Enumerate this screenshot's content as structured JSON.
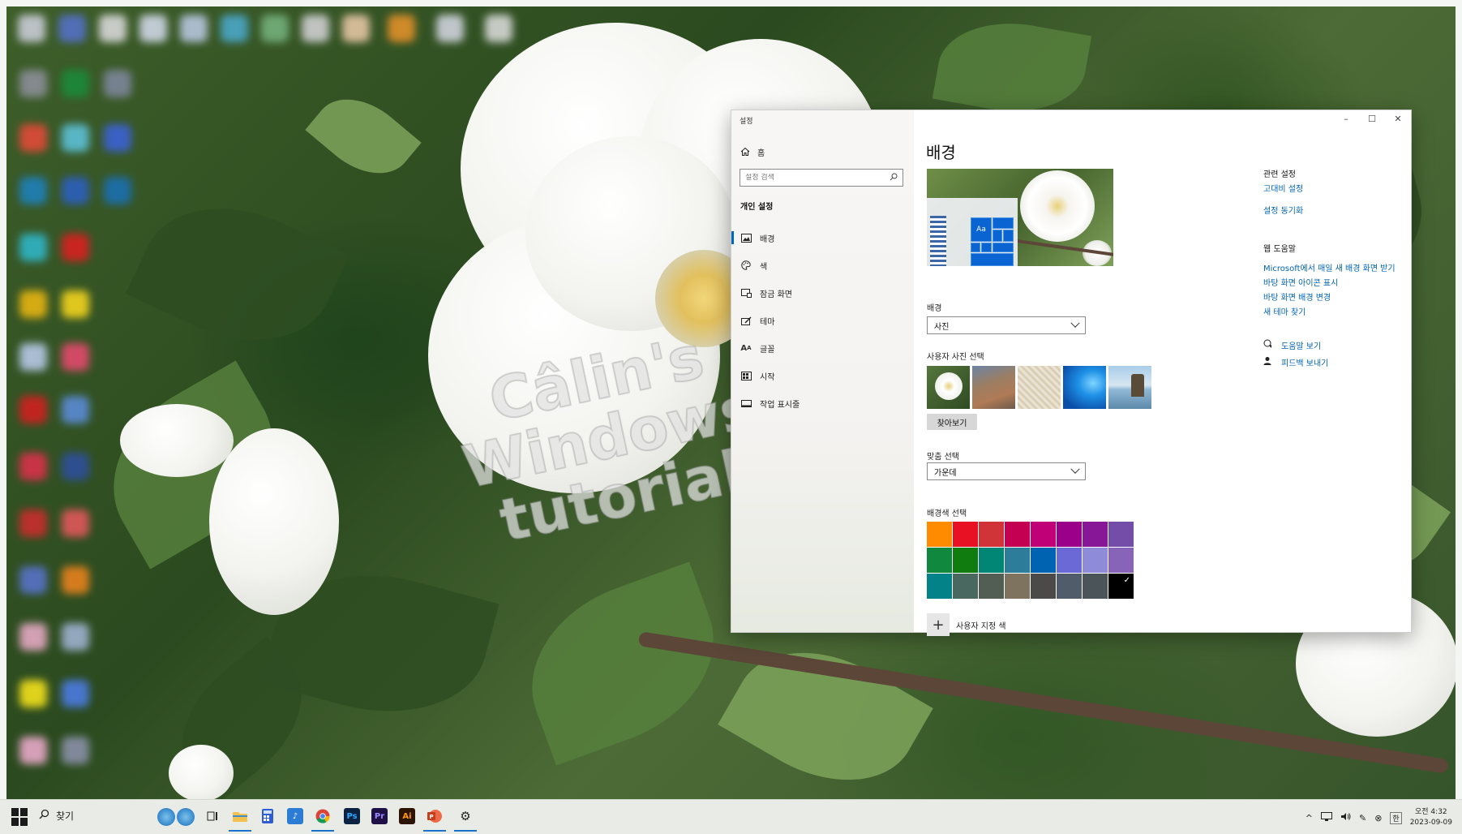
{
  "watermark": {
    "line1": "Câlin's",
    "line2": "Windows",
    "line3": "tutorial"
  },
  "settings": {
    "window_title": "설정",
    "controls": {
      "minimize": "–",
      "maximize": "☐",
      "close": "✕"
    },
    "nav": {
      "home_label": "홈",
      "search_placeholder": "설정 검색",
      "section_title": "개인 설정",
      "items": [
        {
          "label": "배경",
          "icon": "picture-icon",
          "active": true
        },
        {
          "label": "색",
          "icon": "palette-icon",
          "active": false
        },
        {
          "label": "잠금 화면",
          "icon": "lock-screen-icon",
          "active": false
        },
        {
          "label": "테마",
          "icon": "theme-brush-icon",
          "active": false
        },
        {
          "label": "글꼴",
          "icon": "font-icon",
          "active": false
        },
        {
          "label": "시작",
          "icon": "start-grid-icon",
          "active": false
        },
        {
          "label": "작업 표시줄",
          "icon": "taskbar-icon",
          "active": false
        }
      ]
    },
    "content": {
      "page_title": "배경",
      "preview_aa": "Aa",
      "background_label": "배경",
      "background_value": "사진",
      "photo_label": "사용자 사진 선택",
      "browse_label": "찾아보기",
      "fit_label": "맞춤 선택",
      "fit_value": "가운데",
      "color_label": "배경색 선택",
      "selected_color": "#000000",
      "colors": [
        "#ff8c00",
        "#e81123",
        "#d13438",
        "#c30052",
        "#bf0077",
        "#9a0089",
        "#881798",
        "#744da9",
        "#10893e",
        "#107c10",
        "#018574",
        "#2d7d9a",
        "#0063b1",
        "#6b69d6",
        "#8e8cd8",
        "#8764b8",
        "#038387",
        "#486860",
        "#525e54",
        "#7e735f",
        "#4c4a48",
        "#515c6b",
        "#4a5459",
        "#000000"
      ],
      "custom_color_label": "사용자 지정 색"
    },
    "related": {
      "title": "관련 설정",
      "links": [
        "고대비 설정",
        "설정 동기화"
      ]
    },
    "help": {
      "title": "웹 도움말",
      "links": [
        "Microsoft에서 매일 새 배경 화면 받기",
        "바탕 화면 아이콘 표시",
        "바탕 화면 배경 변경",
        "새 테마 찾기"
      ]
    },
    "feedback": {
      "get_help": "도움말 보기",
      "give_feedback": "피드백 보내기"
    }
  },
  "taskbar": {
    "search_label": "찾기",
    "apps": [
      {
        "name": "task-view-icon",
        "label": "",
        "color": "#e9ece6"
      },
      {
        "name": "file-explorer-icon",
        "label": "",
        "color": "#f2c14e"
      },
      {
        "name": "calculator-icon",
        "label": "",
        "color": "#2f5bd3"
      },
      {
        "name": "sticky-app-icon",
        "label": "",
        "color": "#2c7cd6"
      },
      {
        "name": "chrome-icon",
        "label": "",
        "color": "#db4437"
      },
      {
        "name": "photoshop-icon",
        "label": "Ps",
        "color": "#0b2340"
      },
      {
        "name": "premiere-icon",
        "label": "Pr",
        "color": "#1f1045"
      },
      {
        "name": "illustrator-icon",
        "label": "Ai",
        "color": "#2d1402"
      },
      {
        "name": "powerpoint-icon",
        "label": "",
        "color": "#d24726"
      },
      {
        "name": "settings-gear-icon",
        "label": "⚙",
        "color": "#e9ece6"
      }
    ],
    "clock_time": "오전 4:32",
    "clock_date": "2023-09-09",
    "ime": "한"
  }
}
